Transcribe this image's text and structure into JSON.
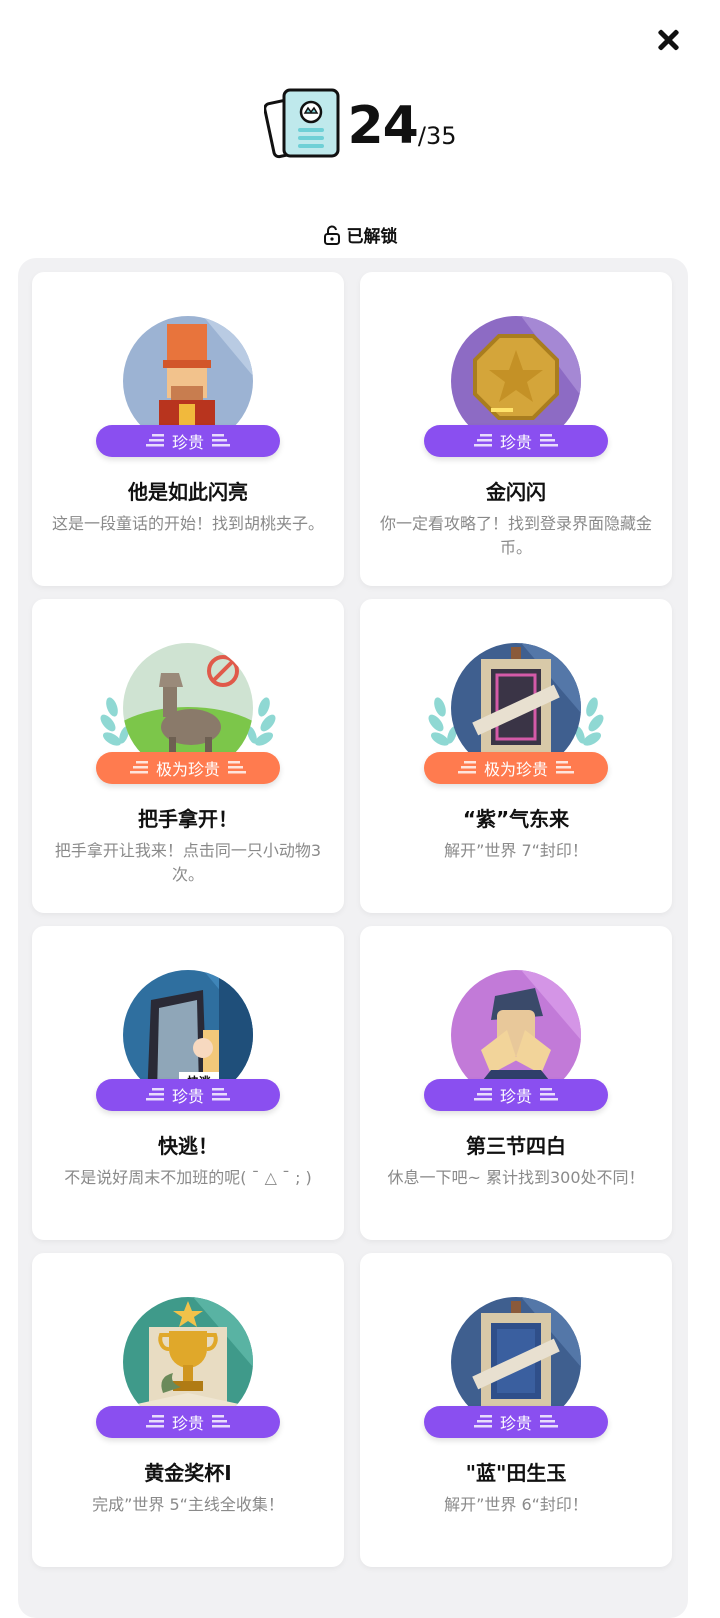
{
  "header": {
    "count": "24",
    "total": "/35",
    "unlocked_label": "已解锁"
  },
  "colors": {
    "rare_badge": "#8a4ff0",
    "epic_badge": "#ff7b4f",
    "panel_bg": "#f1f1f3"
  },
  "achievements": [
    {
      "title": "他是如此闪亮",
      "desc": "这是一段童话的开始！找到胡桃夹子。",
      "badge": "珍贵",
      "rarity": "rare",
      "icon": "nutcracker-icon"
    },
    {
      "title": "金闪闪",
      "desc": "你一定看攻略了！找到登录界面隐藏金币。",
      "badge": "珍贵",
      "rarity": "rare",
      "icon": "gold-coin-icon"
    },
    {
      "title": "把手拿开！",
      "desc": "把手拿开让我来！点击同一只小动物3次。",
      "badge": "极为珍贵",
      "rarity": "epic",
      "icon": "llama-icon"
    },
    {
      "title": "“紫”气东来",
      "desc": "解开”世界 7“封印！",
      "badge": "极为珍贵",
      "rarity": "epic",
      "icon": "purple-easel-icon"
    },
    {
      "title": "快逃！",
      "desc": "不是说好周末不加班的呢( ˉ △ ˉ ; )",
      "badge": "珍贵",
      "rarity": "rare",
      "icon": "escape-door-icon",
      "icon_caption": "快逃"
    },
    {
      "title": "第三节四白",
      "desc": "休息一下吧~ 累计找到300处不同！",
      "badge": "珍贵",
      "rarity": "rare",
      "icon": "eye-exercise-icon"
    },
    {
      "title": "黄金奖杯I",
      "desc": "完成”世界 5“主线全收集！",
      "badge": "珍贵",
      "rarity": "rare",
      "icon": "gold-trophy-icon"
    },
    {
      "title": "\"蓝\"田生玉",
      "desc": "解开”世界 6“封印！",
      "badge": "珍贵",
      "rarity": "rare",
      "icon": "blue-easel-icon"
    }
  ]
}
